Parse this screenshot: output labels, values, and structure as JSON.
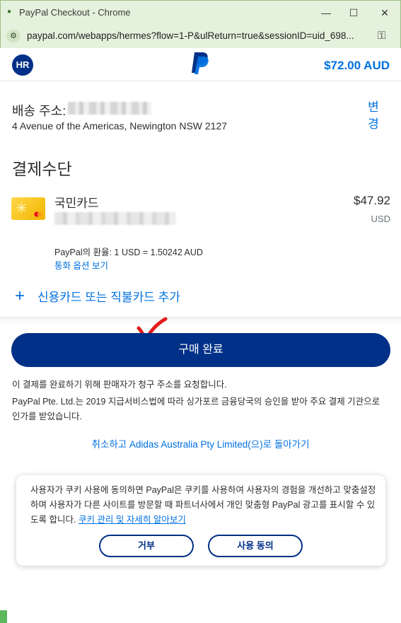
{
  "window": {
    "title": "PayPal Checkout - Chrome",
    "url": "paypal.com/webapps/hermes?flow=1-P&ulReturn=true&sessionID=uid_698..."
  },
  "header": {
    "avatar_initials": "HR",
    "total": "$72.00 AUD",
    "logo_icon": "paypal-logo"
  },
  "shipping": {
    "label": "배송 주소:",
    "address": "4 Avenue of the Americas, Newington NSW 2127",
    "change_label": "변경"
  },
  "payment": {
    "title": "결제수단",
    "card_name": "국민카드",
    "amount": "$47.92",
    "currency": "USD",
    "fx_rate": "PayPal의 환율: 1 USD = 1.50242 AUD",
    "fx_link": "통화 옵션 보기",
    "add_card": "신용카드 또는 직불카드 추가"
  },
  "actions": {
    "buy_label": "구매 완료",
    "notice": "이 결제를 완료하기 위해 판매자가 청구 주소를 요청합니다.",
    "legal": "PayPal Pte. Ltd.는 2019 지급서비스법에 따라 싱가포르 금융당국의 승인을 받아 주요 결제 기관으로 인가를 받았습니다.",
    "cancel": "취소하고 Adidas Australia Pty Limited(으)로 돌아가기"
  },
  "cookie": {
    "text": "사용자가 쿠키 사용에 동의하면 PayPal은 쿠키를 사용하여 사용자의 경험을 개선하고 맞춤설정하며 사용자가 다른 사이트를 방문할 때 파트너사에서 개인 맞춤형 PayPal 광고를 표시할 수 있도록 합니다.",
    "link": "쿠키 관리 및 자세히 알아보기",
    "decline": "거부",
    "accept": "사용 동의"
  },
  "colors": {
    "brand_dark": "#003087",
    "link_blue": "#0070e0",
    "annotation_red": "#e41b1b"
  }
}
